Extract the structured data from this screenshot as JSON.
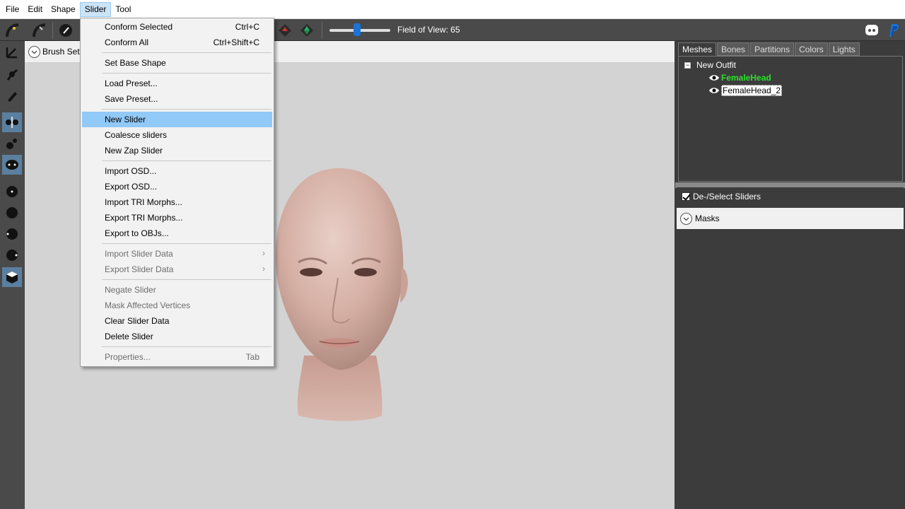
{
  "menubar": {
    "items": [
      "File",
      "Edit",
      "Shape",
      "Slider",
      "Tool"
    ],
    "active": "Slider"
  },
  "toolbar": {
    "fov_label": "Field of View: 65",
    "fov_value": 65
  },
  "viewport": {
    "brush_settings_label": "Brush Sett"
  },
  "right_panel": {
    "tabs": [
      "Meshes",
      "Bones",
      "Partitions",
      "Colors",
      "Lights"
    ],
    "active_tab": "Meshes",
    "tree": {
      "root": "New Outfit",
      "children": [
        "FemaleHead",
        "FemaleHead_2"
      ]
    },
    "sliders_header": "De-/Select Sliders",
    "masks_label": "Masks"
  },
  "slider_menu": {
    "conform_selected": {
      "label": "Conform Selected",
      "shortcut": "Ctrl+C"
    },
    "conform_all": {
      "label": "Conform All",
      "shortcut": "Ctrl+Shift+C"
    },
    "set_base_shape": "Set Base Shape",
    "load_preset": "Load Preset...",
    "save_preset": "Save Preset...",
    "new_slider": "New Slider",
    "coalesce_sliders": "Coalesce sliders",
    "new_zap_slider": "New Zap Slider",
    "import_osd": "Import OSD...",
    "export_osd": "Export OSD...",
    "import_tri": "Import TRI Morphs...",
    "export_tri": "Export TRI Morphs...",
    "export_objs": "Export to OBJs...",
    "import_slider_data": "Import Slider Data",
    "export_slider_data": "Export Slider Data",
    "negate_slider": "Negate Slider",
    "mask_affected": "Mask Affected Vertices",
    "clear_slider_data": "Clear Slider Data",
    "delete_slider": "Delete Slider",
    "properties": {
      "label": "Properties...",
      "shortcut": "Tab"
    }
  },
  "colors": {
    "highlight": "#91c9f7",
    "active_mesh": "#2be02b",
    "accent_blue": "#1a73d8"
  }
}
